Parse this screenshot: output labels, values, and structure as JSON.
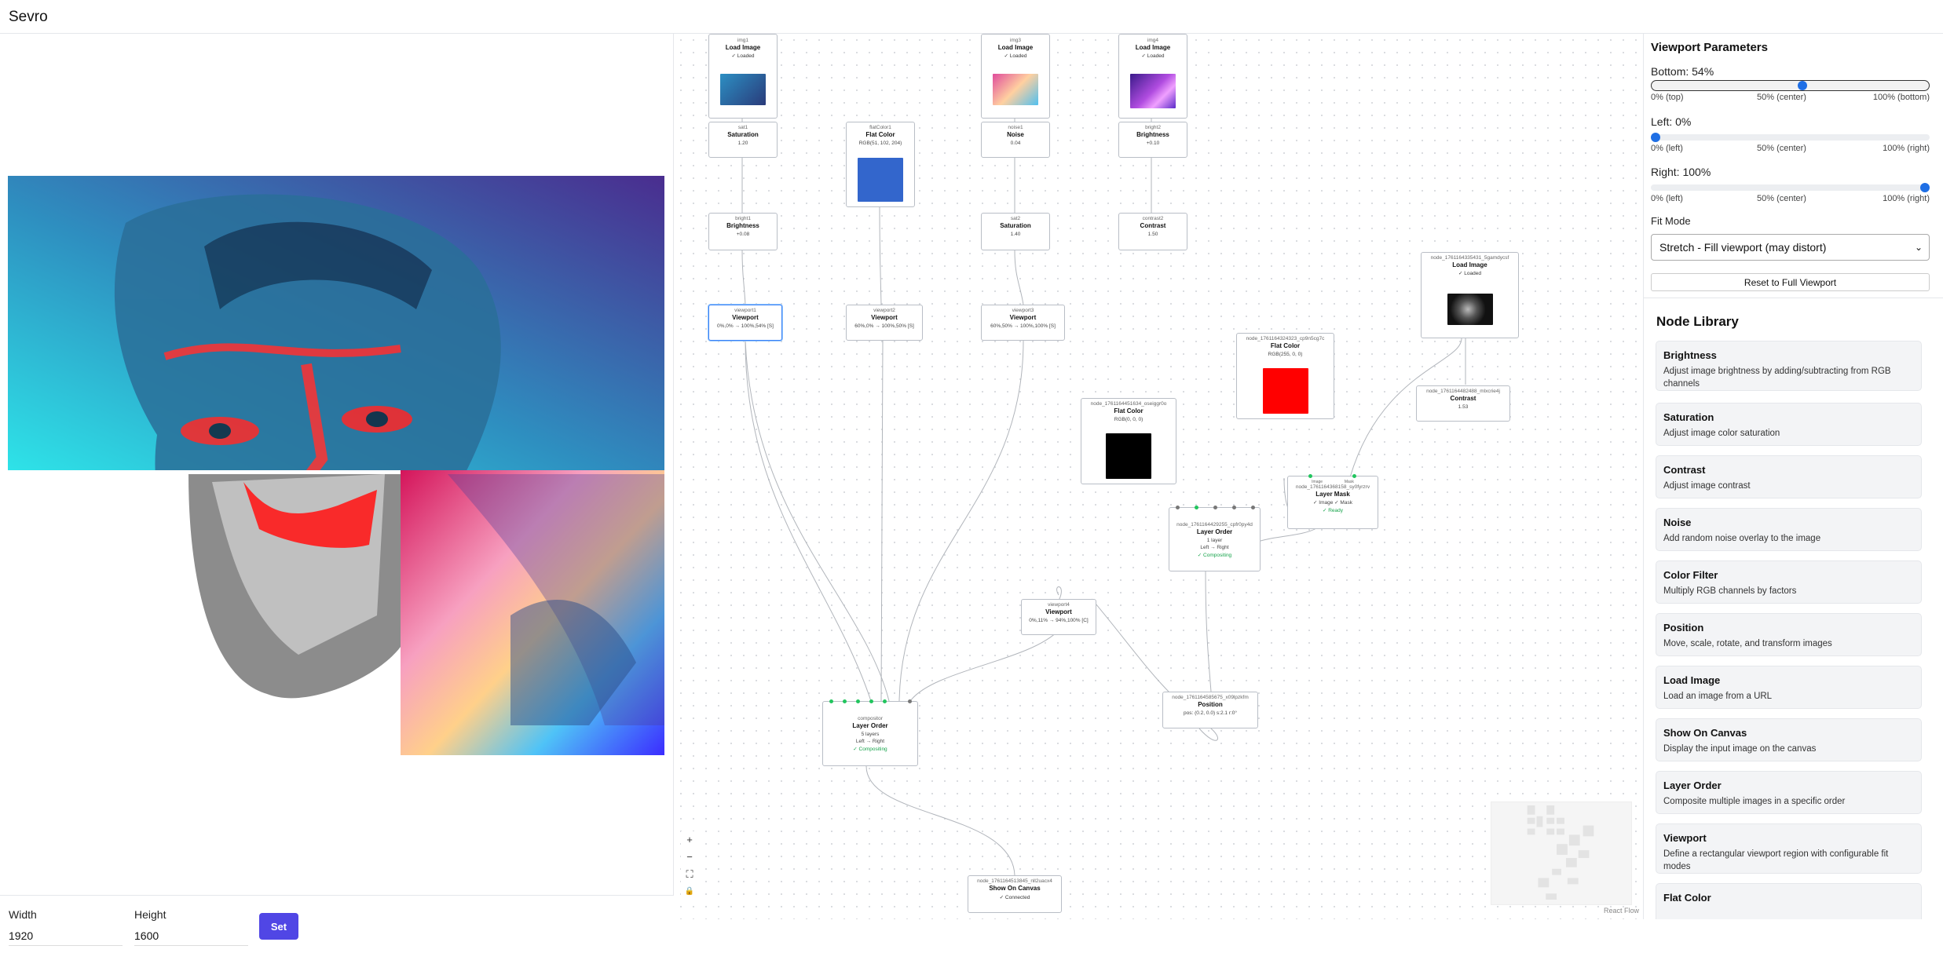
{
  "app": {
    "title": "Sevro"
  },
  "size_controls": {
    "width_label": "Width",
    "width_value": "1920",
    "height_label": "Height",
    "height_value": "1600",
    "set_label": "Set"
  },
  "flow": {
    "nodes": [
      {
        "key": "img1",
        "id": "img1",
        "title": "Load Image",
        "status": "✓ Loaded"
      },
      {
        "key": "img3",
        "id": "img3",
        "title": "Load Image",
        "status": "✓ Loaded"
      },
      {
        "key": "img4",
        "id": "img4",
        "title": "Load Image",
        "status": "✓ Loaded"
      },
      {
        "key": "sat1",
        "id": "sat1",
        "title": "Saturation",
        "value": "1.20"
      },
      {
        "key": "flatColor1",
        "id": "flatColor1",
        "title": "Flat Color",
        "value": "RGB(51, 102, 204)"
      },
      {
        "key": "noise1",
        "id": "noise1",
        "title": "Noise",
        "value": "0.04"
      },
      {
        "key": "bright2",
        "id": "bright2",
        "title": "Brightness",
        "value": "+0.10"
      },
      {
        "key": "bright1",
        "id": "bright1",
        "title": "Brightness",
        "value": "+0.08"
      },
      {
        "key": "sat2",
        "id": "sat2",
        "title": "Saturation",
        "value": "1.40"
      },
      {
        "key": "contrast2",
        "id": "contrast2",
        "title": "Contrast",
        "value": "1.50"
      },
      {
        "key": "viewport1",
        "id": "viewport1",
        "title": "Viewport",
        "value": "0%,0% → 100%,54% [S]"
      },
      {
        "key": "viewport2",
        "id": "viewport2",
        "title": "Viewport",
        "value": "60%,0% → 100%,50% [S]"
      },
      {
        "key": "viewport3",
        "id": "viewport3",
        "title": "Viewport",
        "value": "60%,50% → 100%,100% [S]"
      },
      {
        "key": "loadBw",
        "id": "node_1761164335431_5gamdycsf",
        "title": "Load Image",
        "status": "✓ Loaded"
      },
      {
        "key": "flatRed",
        "id": "node_1761164324323_cp9n5cg7c",
        "title": "Flat Color",
        "value": "RGB(255, 0, 0)"
      },
      {
        "key": "contrastBw",
        "id": "node_1761164482488_mlxcrie4j",
        "title": "Contrast",
        "value": "1.53"
      },
      {
        "key": "flatBlack",
        "id": "node_1761164451634_oseiggr0o",
        "title": "Flat Color",
        "value": "RGB(0, 0, 0)"
      },
      {
        "key": "layerMask",
        "id": "node_1761164368158_sy0fyrzrv",
        "title": "Layer Mask",
        "value": "✓ Image ✓ Mask",
        "status": "✓ Ready",
        "h1": "Image",
        "h2": "Mask"
      },
      {
        "key": "layerOrder2",
        "id": "node_1761164429255_cpfr0py4d",
        "title": "Layer Order",
        "value": "1 layer",
        "value2": "Left → Right",
        "status": "✓ Compositing"
      },
      {
        "key": "viewport4",
        "id": "viewport4",
        "title": "Viewport",
        "value": "0%,11% → 94%,100% [C]"
      },
      {
        "key": "position",
        "id": "node_1761164585675_x09lpzkfm",
        "title": "Position",
        "value": "pos: (0.2, 0.0) s:2.1 r:0°"
      },
      {
        "key": "compositor",
        "id": "compositor",
        "title": "Layer Order",
        "value": "5 layers",
        "value2": "Left → Right",
        "status": "✓ Compositing"
      },
      {
        "key": "showCanvas",
        "id": "node_1761164513845_nll2uacx4",
        "title": "Show On Canvas",
        "status": "✓ Connected"
      }
    ],
    "controls": {
      "zoom_in": "+",
      "zoom_out": "−",
      "fit": "⛶",
      "lock": "🔒"
    },
    "attribution": "React Flow"
  },
  "viewport_params": {
    "title": "Viewport Parameters",
    "bottom_label": "Bottom: 54%",
    "bottom_value": 54,
    "bottom_ticks": [
      "0% (top)",
      "50% (center)",
      "100% (bottom)"
    ],
    "left_label": "Left: 0%",
    "left_value": 0,
    "left_ticks": [
      "0% (left)",
      "50% (center)",
      "100% (right)"
    ],
    "right_label": "Right: 100%",
    "right_value": 100,
    "right_ticks": [
      "0% (left)",
      "50% (center)",
      "100% (right)"
    ],
    "fit_mode_label": "Fit Mode",
    "fit_mode_value": "Stretch - Fill viewport (may distort)",
    "reset_label": "Reset to Full Viewport"
  },
  "node_library": {
    "title": "Node Library",
    "items": [
      {
        "name": "Brightness",
        "desc": "Adjust image brightness by adding/subtracting from RGB channels"
      },
      {
        "name": "Saturation",
        "desc": "Adjust image color saturation"
      },
      {
        "name": "Contrast",
        "desc": "Adjust image contrast"
      },
      {
        "name": "Noise",
        "desc": "Add random noise overlay to the image"
      },
      {
        "name": "Color Filter",
        "desc": "Multiply RGB channels by factors"
      },
      {
        "name": "Position",
        "desc": "Move, scale, rotate, and transform images"
      },
      {
        "name": "Load Image",
        "desc": "Load an image from a URL"
      },
      {
        "name": "Show On Canvas",
        "desc": "Display the input image on the canvas"
      },
      {
        "name": "Layer Order",
        "desc": "Composite multiple images in a specific order"
      },
      {
        "name": "Viewport",
        "desc": "Define a rectangular viewport region with configurable fit modes"
      },
      {
        "name": "Flat Color",
        "desc": ""
      }
    ]
  },
  "colors": {
    "accent": "#5046e5",
    "slider_thumb": "#1f6fe5",
    "flat_color_1": "#3366cc",
    "flat_red": "#ff0000",
    "flat_black": "#000000",
    "ok_green": "#16a34a"
  }
}
